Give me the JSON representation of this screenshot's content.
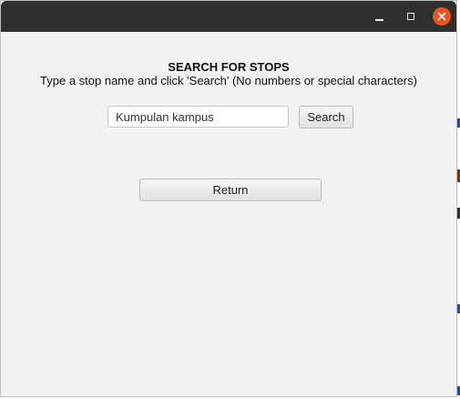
{
  "window": {
    "controls": {
      "minimize_icon": "minimize-icon",
      "maximize_icon": "maximize-icon",
      "close_icon": "close-icon",
      "close_color": "#e95420",
      "close_glyph": "✕"
    }
  },
  "main": {
    "heading": "SEARCH FOR STOPS",
    "instructions": "Type a stop name and click 'Search' (No numbers or special characters)",
    "search": {
      "value": "Kumpulan kampus",
      "button_label": "Search"
    },
    "return_label": "Return"
  }
}
